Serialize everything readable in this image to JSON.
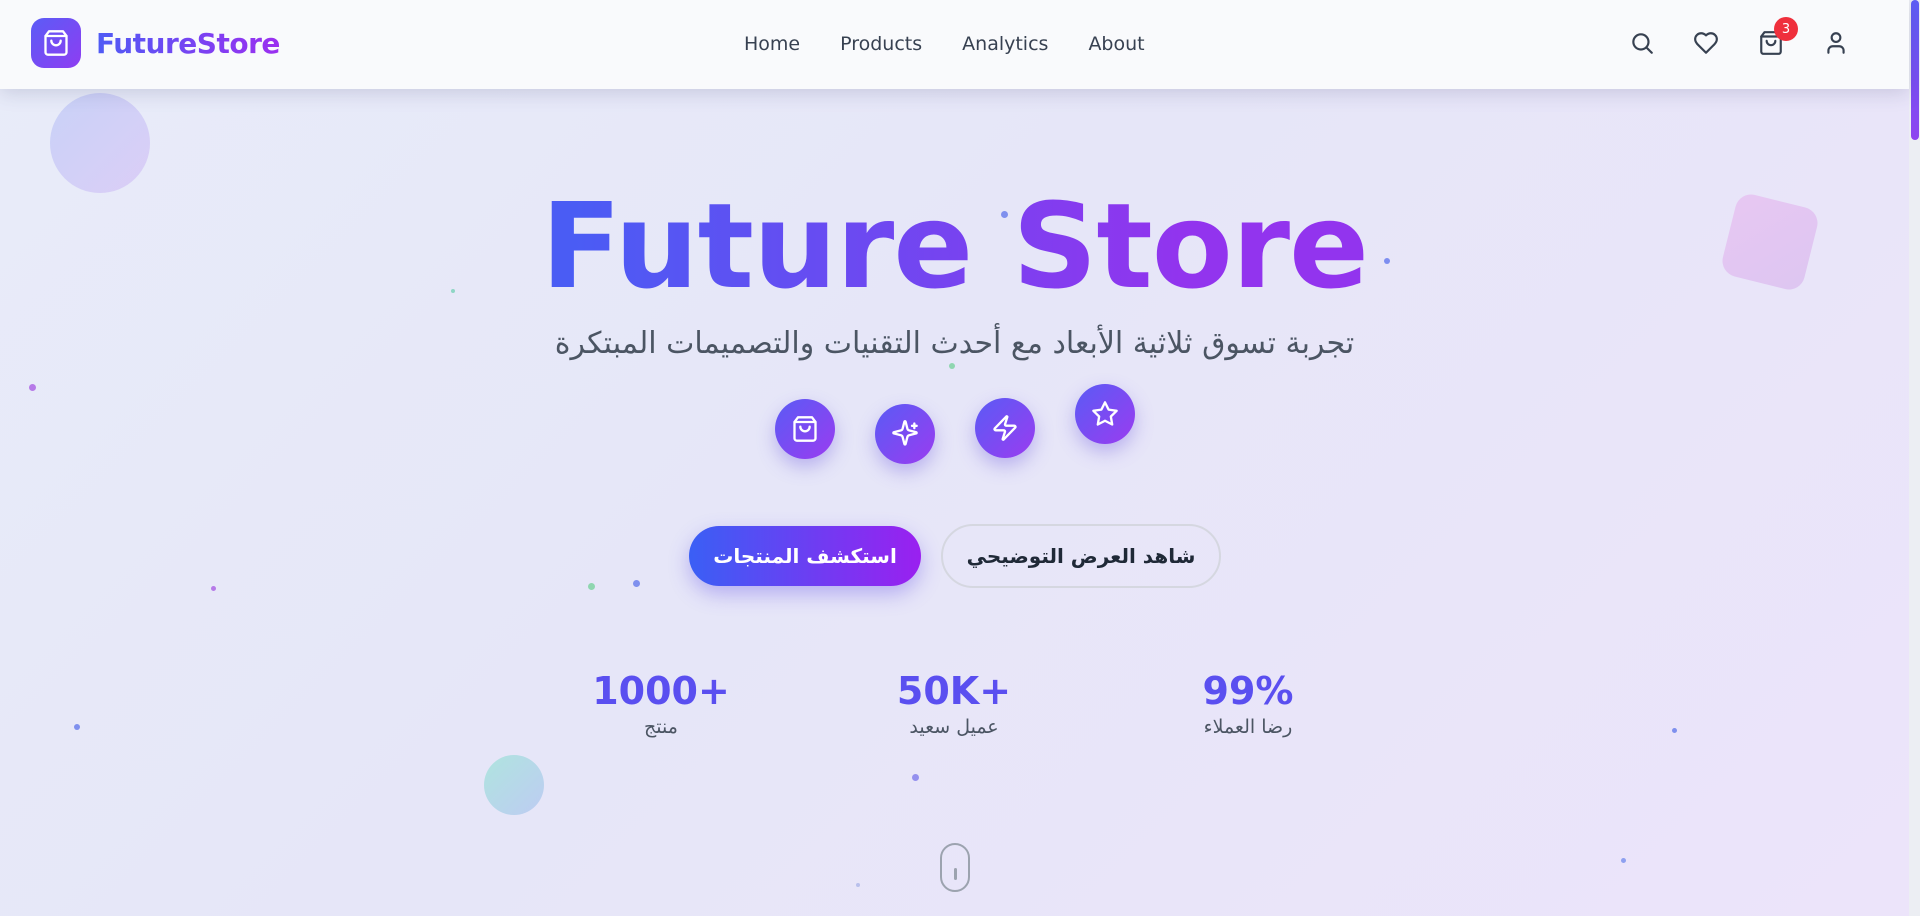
{
  "header": {
    "brand": "FutureStore",
    "logo_icon": "shopping-bag-icon",
    "nav": [
      {
        "label": "Home"
      },
      {
        "label": "Products"
      },
      {
        "label": "Analytics"
      },
      {
        "label": "About"
      }
    ],
    "icons": [
      "search-icon",
      "heart-icon",
      "cart-icon",
      "user-icon"
    ],
    "cart_count": "3"
  },
  "hero": {
    "title": "Future Store",
    "subtitle": "تجربة تسوق ثلاثية الأبعاد مع أحدث التقنيات والتصميمات المبتكرة",
    "feature_icons": [
      "shopping-bag-icon",
      "sparkles-icon",
      "zap-icon",
      "star-icon"
    ],
    "primary_button": "استكشف المنتجات",
    "secondary_button": "شاهد العرض التوضيحي"
  },
  "stats": [
    {
      "value": "1000+",
      "label": "منتج"
    },
    {
      "value": "50K+",
      "label": "عميل سعيد"
    },
    {
      "value": "99%",
      "label": "رضا العملاء"
    }
  ],
  "colors": {
    "brand_start": "#4f5bf5",
    "brand_end": "#9b2ff0",
    "badge": "#ef2f3c",
    "stat_value": "#5a4ff0"
  }
}
